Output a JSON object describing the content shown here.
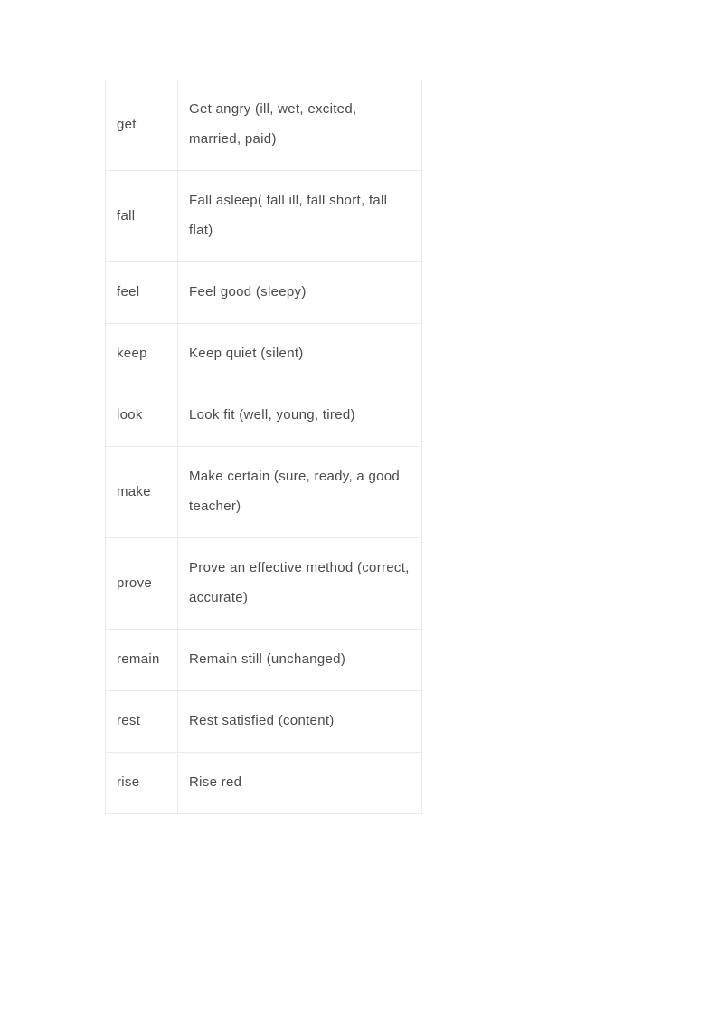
{
  "table": {
    "rows": [
      {
        "verb": "get",
        "example": "Get   angry (ill, wet, excited, married, paid)"
      },
      {
        "verb": "fall",
        "example": "Fall asleep( fall ill, fall short, fall flat)"
      },
      {
        "verb": "feel",
        "example": "Feel good (sleepy)"
      },
      {
        "verb": "keep",
        "example": "Keep quiet   (silent)"
      },
      {
        "verb": "look",
        "example": "Look   fit (well, young, tired)"
      },
      {
        "verb": "make",
        "example": "Make   certain (sure, ready, a good teacher)"
      },
      {
        "verb": "prove",
        "example": "Prove   an effective method (correct, accurate)"
      },
      {
        "verb": "remain",
        "example": "Remain   still (unchanged)"
      },
      {
        "verb": "rest",
        "example": "Rest   satisfied (content)"
      },
      {
        "verb": "rise",
        "example": "Rise   red"
      }
    ]
  }
}
